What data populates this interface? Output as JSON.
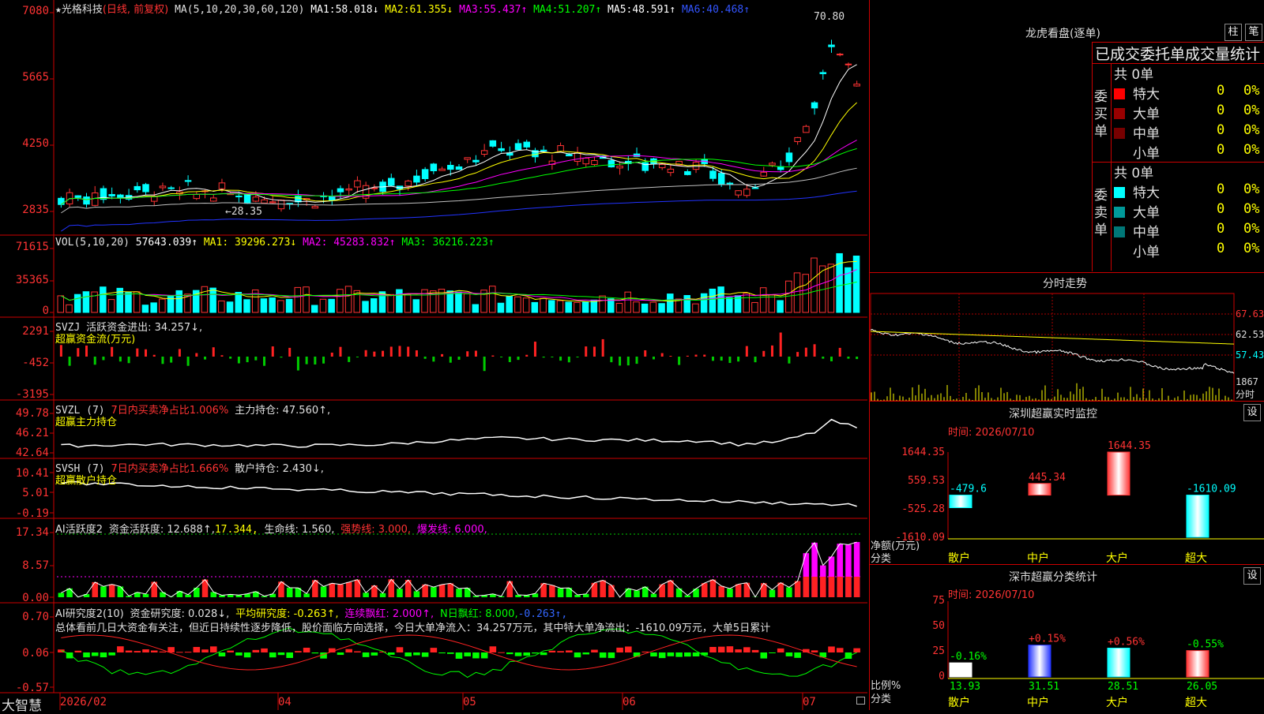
{
  "stock": {
    "name": "光格科技",
    "mode": "(日线, 前复权)",
    "marker": "★"
  },
  "panels": {
    "kline": {
      "ma_title": "MA(5,10,20,30,60,120)",
      "ma": [
        {
          "label": "MA1:",
          "value": "58.018↓",
          "color": "#ffffff"
        },
        {
          "label": "MA2:",
          "value": "61.355↓",
          "color": "#ffff00"
        },
        {
          "label": "MA3:",
          "value": "55.437↑",
          "color": "#ff00ff"
        },
        {
          "label": "MA4:",
          "value": "51.207↑",
          "color": "#00ff00"
        },
        {
          "label": "MA5:",
          "value": "48.591↑",
          "color": "#c0c0c0"
        },
        {
          "label": "MA6:",
          "value": "40.468↑",
          "color": "#0000ff"
        }
      ],
      "yticks": [
        "70.80",
        "56.65",
        "42.50",
        "28.35"
      ],
      "yticks_shown": [
        "7080",
        "5665",
        "4250",
        "2835"
      ],
      "high_label": "70.80",
      "low_label": "28.35"
    },
    "vol": {
      "title": "VOL(5,10,20)",
      "value": "57643.039↑",
      "ma1": "MA1: 39296.273↓",
      "ma2": "MA2: 45283.832↑",
      "ma3": "MA3: 36216.223↑",
      "yticks": [
        "71615",
        "35365",
        "0"
      ]
    },
    "svzj": {
      "title": "SVZJ",
      "label": "活跃资金进出: 34.257↓,",
      "sub": "超赢资金流(万元)",
      "yticks": [
        "2291",
        "-452",
        "-3195"
      ]
    },
    "svzl": {
      "title": "SVZL (7)",
      "label1": "7日内买卖净占比1.006%",
      "label2": "主力持仓: 47.560↑,",
      "sub": "超赢主力持仓",
      "yticks": [
        "49.78",
        "46.21",
        "42.64"
      ]
    },
    "svsh": {
      "title": "SVSH (7)",
      "label1": "7日内买卖净占比1.666%",
      "label2": "散户持仓: 2.430↓,",
      "sub": "超赢散户持仓",
      "yticks": [
        "10.41",
        "5.01",
        "-0.19"
      ]
    },
    "ai_active": {
      "title": "AI活跃度2",
      "label1": "资金活跃度: 12.688↑,",
      "label2": "17.344,",
      "label3": "生命线: 1.560,",
      "label4": "强势线: 3.000,",
      "label5": "爆发线: 6.000,",
      "yticks": [
        "17.34",
        "8.57",
        "0.00"
      ]
    },
    "ai_research": {
      "title": "AI研究度2(10)",
      "label1": "资金研究度: 0.028↓,",
      "label2": "平均研究度: -0.263↑,",
      "label3": "连续飘红: 2.000↑,",
      "label4": "N日飘红: 8.000,",
      "label5": "-0.263↑,",
      "summary": "总体看前几日大资金有关注，但近日持续性逐步降低，股价面临方向选择，今日大单净流入：34.257万元，其中特大单净流出：-1610.09万元，大单5日累计",
      "yticks": [
        "0.70",
        "0.06",
        "-0.57"
      ]
    }
  },
  "xaxis": {
    "brand": "大智慧",
    "labels": [
      "2026/02",
      "04",
      "05",
      "06",
      "07"
    ]
  },
  "longhu": {
    "title": "龙虎看盘(逐单)",
    "btn1": "柱",
    "btn2": "笔",
    "subtitle": "已成交委托单成交量统计",
    "buy": {
      "side": "委买单",
      "total": "共 0单",
      "rows": [
        {
          "name": "特大",
          "v": "0",
          "p": "0%",
          "color": "#ff0000"
        },
        {
          "name": "大单",
          "v": "0",
          "p": "0%",
          "color": "#990000"
        },
        {
          "name": "中单",
          "v": "0",
          "p": "0%",
          "color": "#770000"
        },
        {
          "name": "小单",
          "v": "0",
          "p": "0%",
          "color": "#000000"
        }
      ]
    },
    "sell": {
      "side": "委卖单",
      "total": "共 0单",
      "rows": [
        {
          "name": "特大",
          "v": "0",
          "p": "0%",
          "color": "#00ffff"
        },
        {
          "name": "大单",
          "v": "0",
          "p": "0%",
          "color": "#009999"
        },
        {
          "name": "中单",
          "v": "0",
          "p": "0%",
          "color": "#007777"
        },
        {
          "name": "小单",
          "v": "0",
          "p": "0%",
          "color": "#000000"
        }
      ]
    }
  },
  "intraday": {
    "title": "分时走势",
    "yticks": [
      "67.63",
      "62.53",
      "57.43"
    ],
    "vol_tick": "1867",
    "vol_label": "分时"
  },
  "monitor": {
    "title": "深圳超赢实时监控",
    "btn": "设",
    "time": "时间: 2026/07/10",
    "yticks": [
      "1644.35",
      "559.53",
      "-525.28",
      "-1610.09"
    ],
    "ylabel": "净额(万元)",
    "xlabel": "分类",
    "chart_data": {
      "type": "bar",
      "categories": [
        "散户",
        "中户",
        "大户",
        "超大"
      ],
      "values": [
        -479.6,
        445.34,
        1644.35,
        -1610.09
      ],
      "ylim": [
        -1610.09,
        1644.35
      ]
    }
  },
  "classify": {
    "title": "深市超赢分类统计",
    "btn": "设",
    "time": "时间: 2026/07/10",
    "yticks": [
      "75",
      "50",
      "25",
      "0"
    ],
    "ylabel": "比例%",
    "xlabel": "分类",
    "chart_data": {
      "type": "bar",
      "categories": [
        "散户",
        "中户",
        "大户",
        "超大"
      ],
      "values": [
        13.93,
        31.51,
        28.51,
        26.05
      ],
      "changes": [
        "-0.16%",
        "+0.15%",
        "+0.56%",
        "-0.55%"
      ],
      "ylim": [
        0,
        75
      ]
    }
  }
}
